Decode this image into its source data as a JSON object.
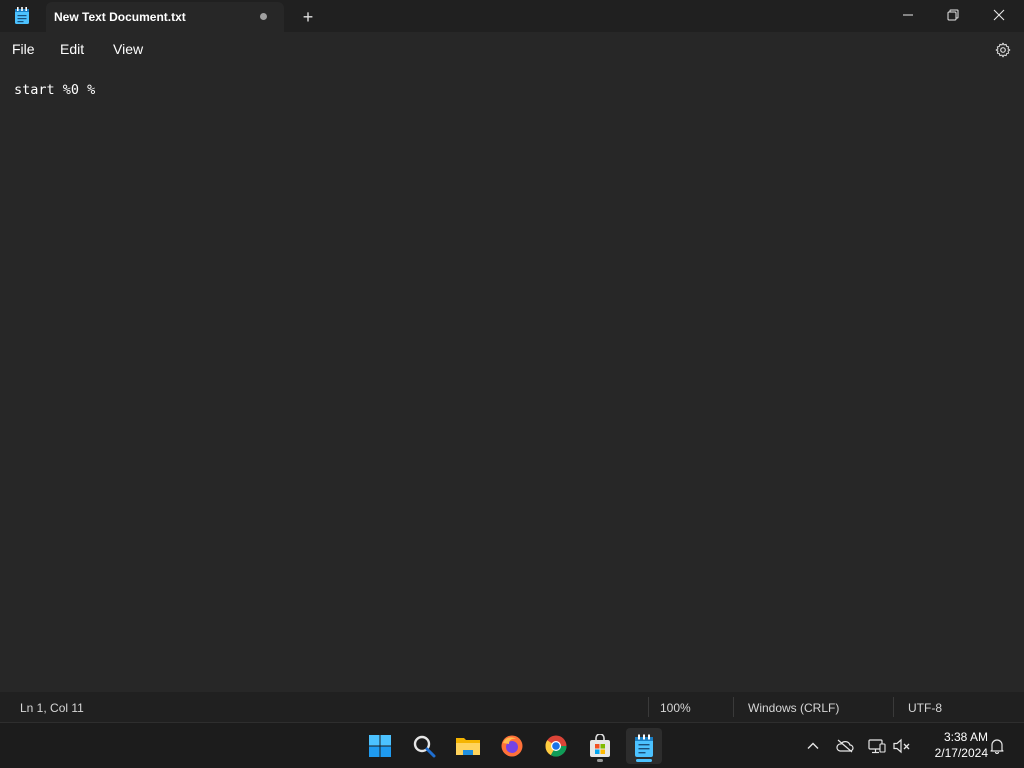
{
  "window": {
    "tab_title": "New Text Document.txt",
    "new_tab_symbol": "+",
    "icons": {
      "app": "notepad-icon",
      "unsaved": "unsaved-dot-icon",
      "minimize": "minimize-icon",
      "maximize": "restore-icon",
      "close": "close-icon"
    }
  },
  "menu": {
    "items": [
      "File",
      "Edit",
      "View"
    ],
    "settings_icon": "gear-icon"
  },
  "editor": {
    "content": "start %0 %"
  },
  "status": {
    "position": "Ln 1, Col 11",
    "zoom": "100%",
    "line_ending": "Windows (CRLF)",
    "encoding": "UTF-8"
  },
  "taskbar": {
    "apps": [
      {
        "name": "start-icon",
        "active": false
      },
      {
        "name": "search-icon",
        "active": false
      },
      {
        "name": "file-explorer-icon",
        "active": false
      },
      {
        "name": "firefox-icon",
        "active": false
      },
      {
        "name": "chrome-icon",
        "active": false
      },
      {
        "name": "microsoft-store-icon",
        "active": false,
        "running": true
      },
      {
        "name": "notepad-icon",
        "active": true
      }
    ],
    "tray": [
      "chevron-up-icon",
      "onedrive-offline-icon",
      "network-icon",
      "volume-muted-icon"
    ],
    "clock": {
      "time": "3:38 AM",
      "date": "2/17/2024"
    },
    "notification_icon": "bell-icon"
  },
  "colors": {
    "accent": "#4cc2ff",
    "background": "#272727",
    "titlebar": "#202020"
  }
}
